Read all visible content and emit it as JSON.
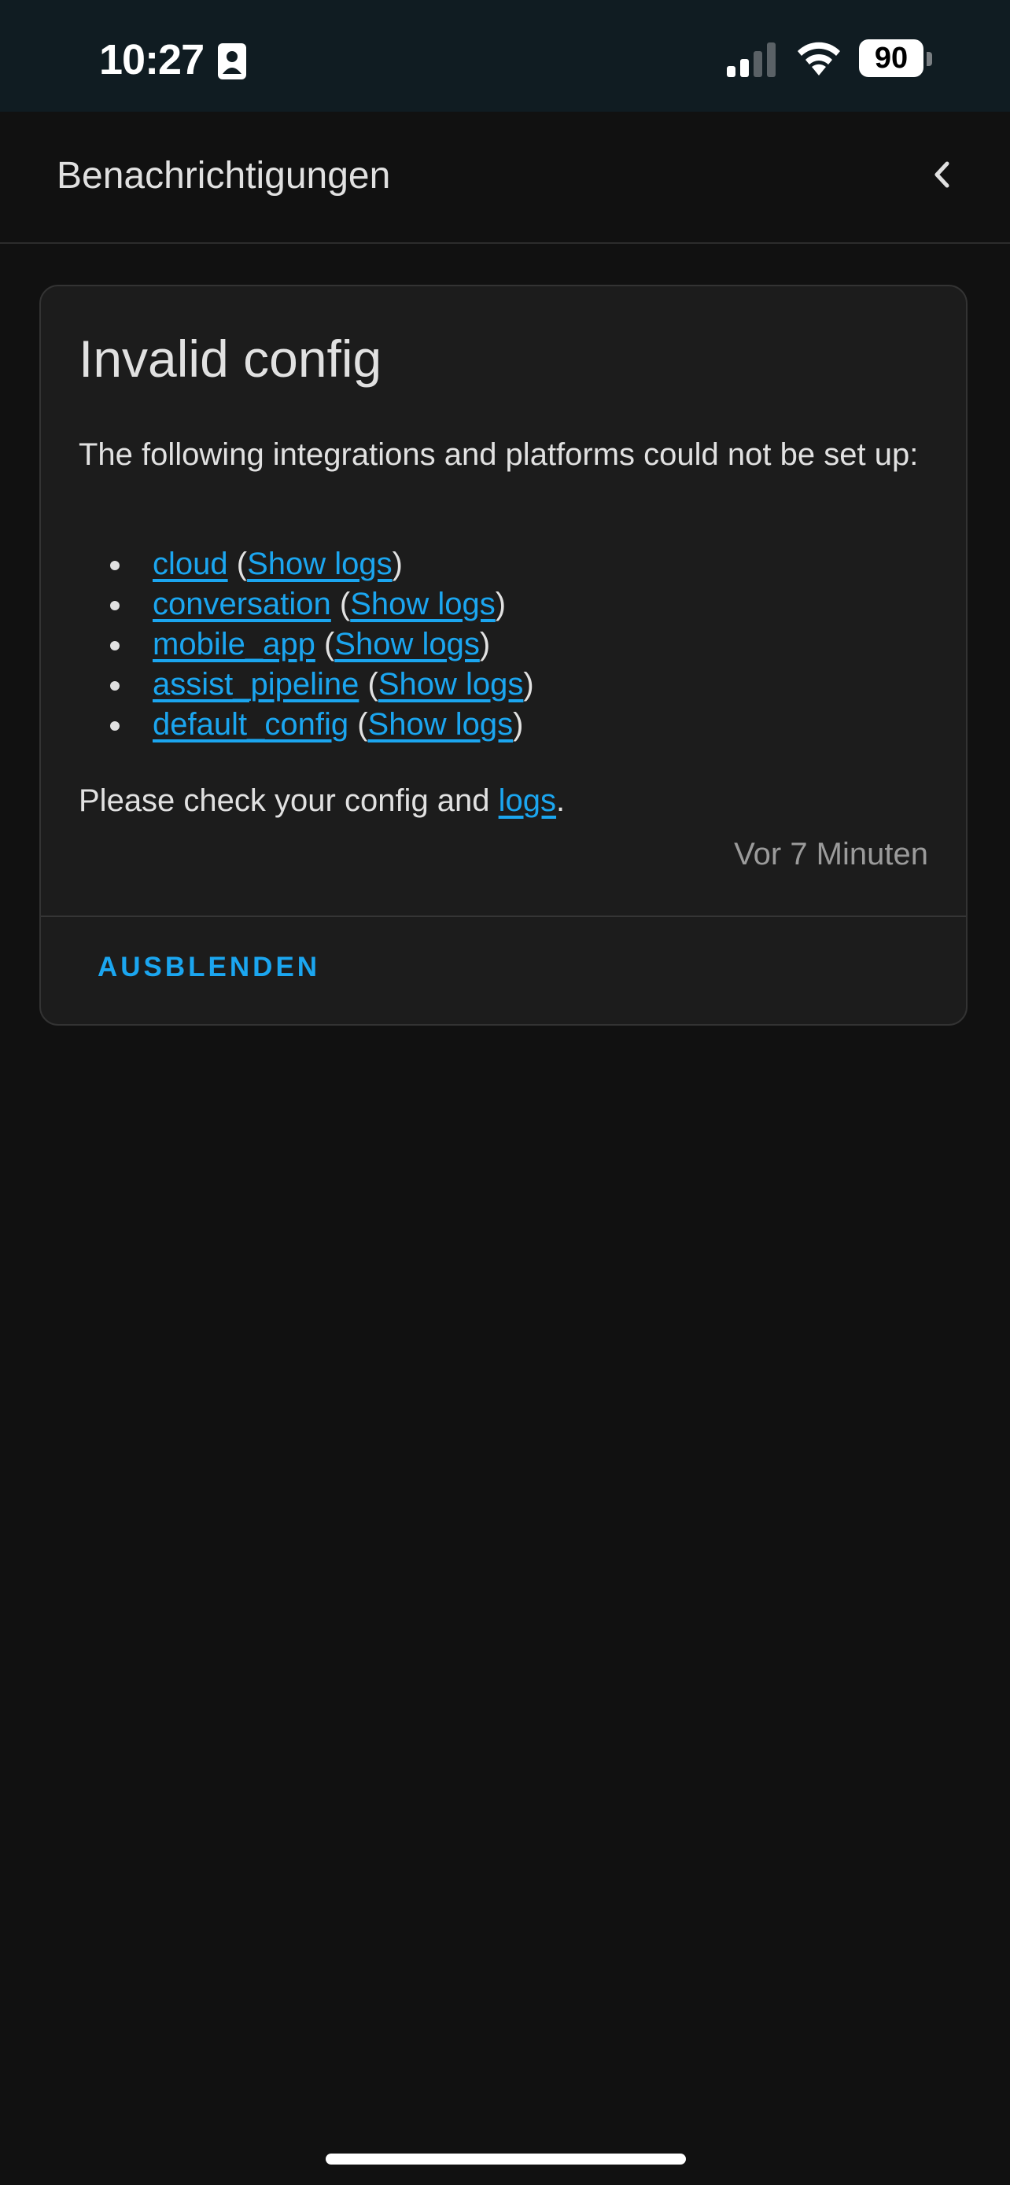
{
  "status_bar": {
    "time": "10:27",
    "battery_level": "90",
    "signal_bars_active": 2,
    "signal_bars_total": 4
  },
  "header": {
    "title": "Benachrichtigungen"
  },
  "card": {
    "title": "Invalid config",
    "intro": "The following integrations and platforms could not be set up:",
    "items": [
      {
        "name": "cloud",
        "logs_label": "Show logs"
      },
      {
        "name": "conversation",
        "logs_label": "Show logs"
      },
      {
        "name": "mobile_app",
        "logs_label": "Show logs"
      },
      {
        "name": "assist_pipeline",
        "logs_label": "Show logs"
      },
      {
        "name": "default_config",
        "logs_label": "Show logs"
      }
    ],
    "footer_text": "Please check your config and ",
    "footer_link": "logs",
    "footer_end": ".",
    "timestamp": "Vor 7 Minuten",
    "dismiss_label": "AUSBLENDEN"
  },
  "colors": {
    "accent": "#1ba6f0",
    "background": "#111111",
    "card": "#1c1c1c",
    "status_bar": "#101c22"
  }
}
